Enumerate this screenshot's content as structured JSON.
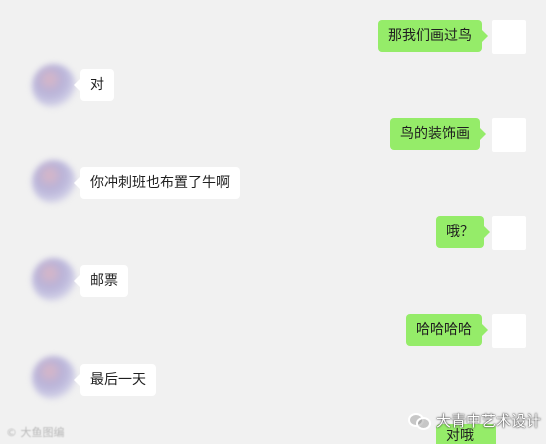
{
  "messages": [
    {
      "side": "right",
      "text": "那我们画过鸟"
    },
    {
      "side": "left",
      "text": "对"
    },
    {
      "side": "right",
      "text": "鸟的装饰画"
    },
    {
      "side": "left",
      "text": "你冲刺班也布置了牛啊"
    },
    {
      "side": "right",
      "text": "哦？"
    },
    {
      "side": "left",
      "text": "邮票"
    },
    {
      "side": "right",
      "text": "哈哈哈哈"
    },
    {
      "side": "left",
      "text": "最后一天"
    },
    {
      "side": "right",
      "text": "对哦"
    }
  ],
  "watermark": {
    "left_text": "© 大鱼图编",
    "right_text": "大青中艺术设计",
    "icon": "wechat-icon"
  },
  "colors": {
    "background": "#f1f1f1",
    "self_bubble": "#95ec69",
    "other_bubble": "#ffffff"
  }
}
